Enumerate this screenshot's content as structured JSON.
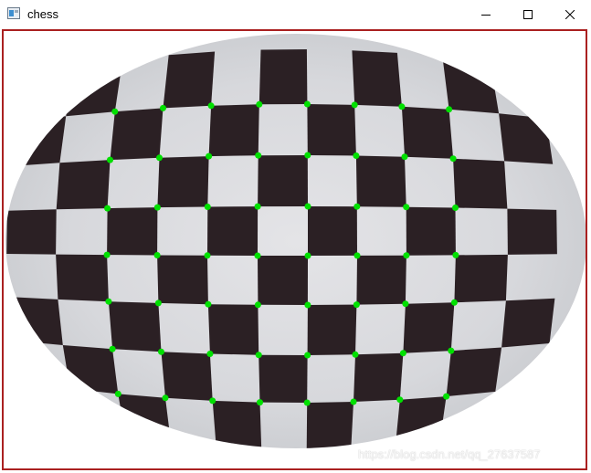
{
  "window": {
    "title": "chess"
  },
  "controls": {
    "minimize": "minimize-icon",
    "maximize": "maximize-icon",
    "close": "close-icon"
  },
  "image": {
    "description_icon": "chessboard-calibration-image",
    "board_rows": 8,
    "board_cols": 9,
    "corner_color": "#00e000",
    "dark_square_color": "#2b2024",
    "light_square_color": "#d9d9dc",
    "frame_color": "#aa2020"
  },
  "watermark": "https://blog.csdn.net/qq_27637587"
}
